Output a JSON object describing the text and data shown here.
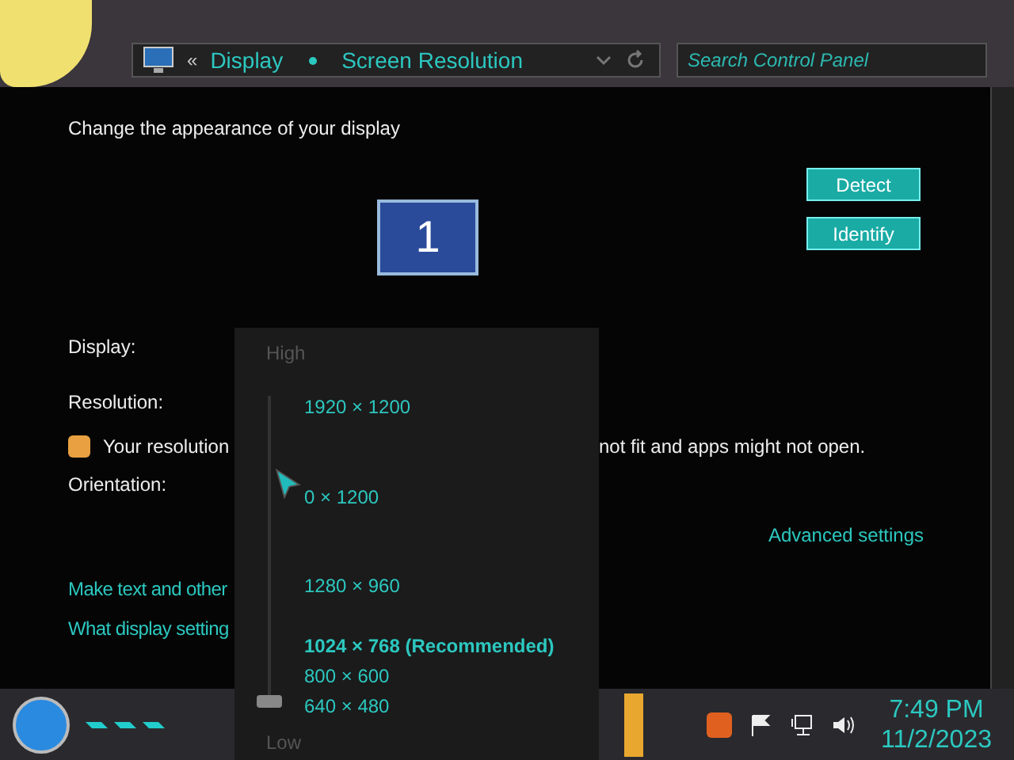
{
  "address_bar": {
    "separator": "«",
    "crumbs": [
      "Display",
      "Screen Resolution"
    ]
  },
  "search": {
    "placeholder": "Search Control Panel"
  },
  "heading": "Change the appearance of your display",
  "monitor": {
    "number": "1"
  },
  "buttons": [
    "Detect",
    "Identify"
  ],
  "fields": [
    {
      "label": "Display:"
    },
    {
      "label": "Resolution:"
    }
  ],
  "warning": {
    "left": "Your resolution",
    "right": "not fit and apps might not open."
  },
  "orientation_label": "Orientation:",
  "advanced_link": "Advanced settings",
  "links": [
    "Make text and other",
    "What display setting"
  ],
  "resolution_popup": {
    "high_label": "High",
    "low_label": "Low",
    "level": 0,
    "options": [
      {
        "label": "1920 × 1200",
        "recommended": false
      },
      {
        "label": "0 × 1200",
        "recommended": false
      },
      {
        "label": "1280 × 960",
        "recommended": false
      },
      {
        "label": "1024 × 768 (Recommended)",
        "recommended": true
      },
      {
        "label": "800 × 600",
        "recommended": false
      },
      {
        "label": "640 × 480",
        "recommended": false
      }
    ]
  },
  "clock": {
    "time": "7:49 PM",
    "date": "11/2/2023"
  }
}
